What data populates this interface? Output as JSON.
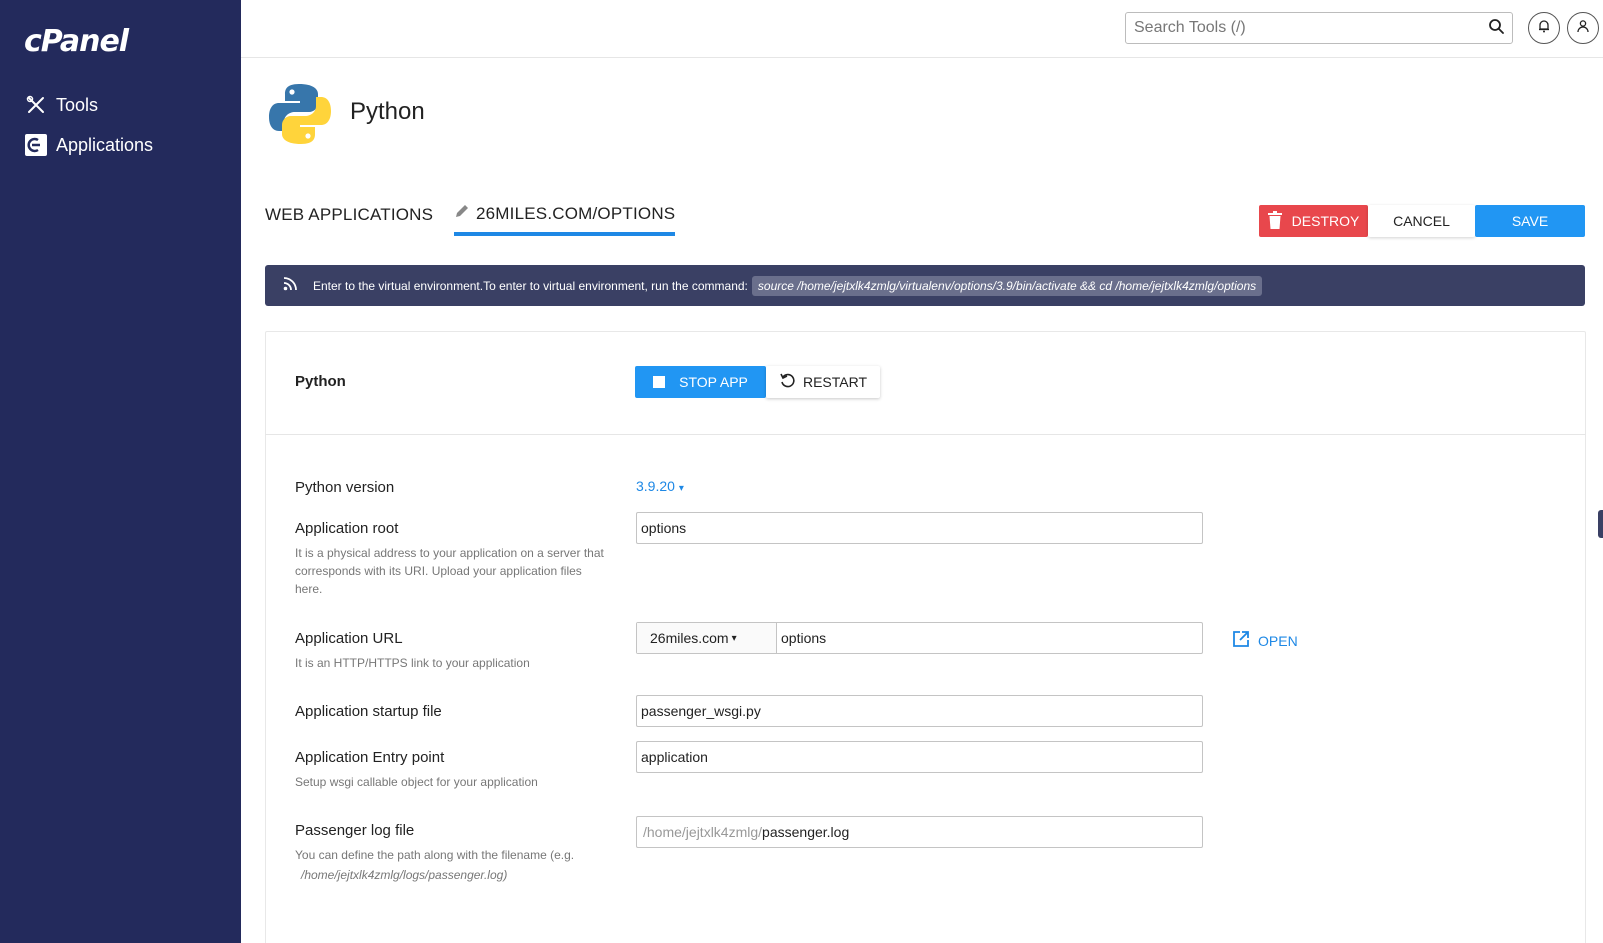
{
  "brand": {
    "logo_text": "cPanel"
  },
  "sidebar": {
    "items": [
      {
        "label": "Tools",
        "icon": "tools-icon"
      },
      {
        "label": "Applications",
        "icon": "applications-icon"
      }
    ]
  },
  "topbar": {
    "search_placeholder": "Search Tools (/)",
    "search_value": ""
  },
  "header": {
    "title": "Python"
  },
  "tabs": [
    {
      "label": "WEB APPLICATIONS",
      "active": false
    },
    {
      "label": "26MILES.COM/OPTIONS",
      "active": true
    }
  ],
  "actions": {
    "destroy_label": "DESTROY",
    "cancel_label": "CANCEL",
    "save_label": "SAVE"
  },
  "banner": {
    "text": "Enter to the virtual environment.To enter to virtual environment, run the command:",
    "command": "source /home/jejtxlk4zmlg/virtualenv/options/3.9/bin/activate && cd /home/jejtxlk4zmlg/options"
  },
  "app_control": {
    "label": "Python",
    "stop_label": "STOP APP",
    "restart_label": "RESTART"
  },
  "form": {
    "python_version": {
      "label": "Python version",
      "value": "3.9.20"
    },
    "app_root": {
      "label": "Application root",
      "help": "It is a physical address to your application on a server that corresponds with its URI. Upload your application files here.",
      "value": "options"
    },
    "app_url": {
      "label": "Application URL",
      "help": "It is an HTTP/HTTPS link to your application",
      "domain": "26miles.com",
      "path": "options",
      "open_label": "OPEN"
    },
    "startup_file": {
      "label": "Application startup file",
      "value": "passenger_wsgi.py"
    },
    "entry_point": {
      "label": "Application Entry point",
      "help": "Setup wsgi callable object for your application",
      "value": "application"
    },
    "log_file": {
      "label": "Passenger log file",
      "help": "You can define the path along with the filename (e.g.",
      "help_path": "/home/jejtxlk4zmlg/logs/passenger.log)",
      "prefix": "/home/jejtxlk4zmlg/",
      "value": "passenger.log"
    }
  },
  "colors": {
    "sidebar_bg": "#232a5c",
    "accent": "#2196f3",
    "danger": "#e8474c",
    "banner_bg": "#3a4064"
  }
}
